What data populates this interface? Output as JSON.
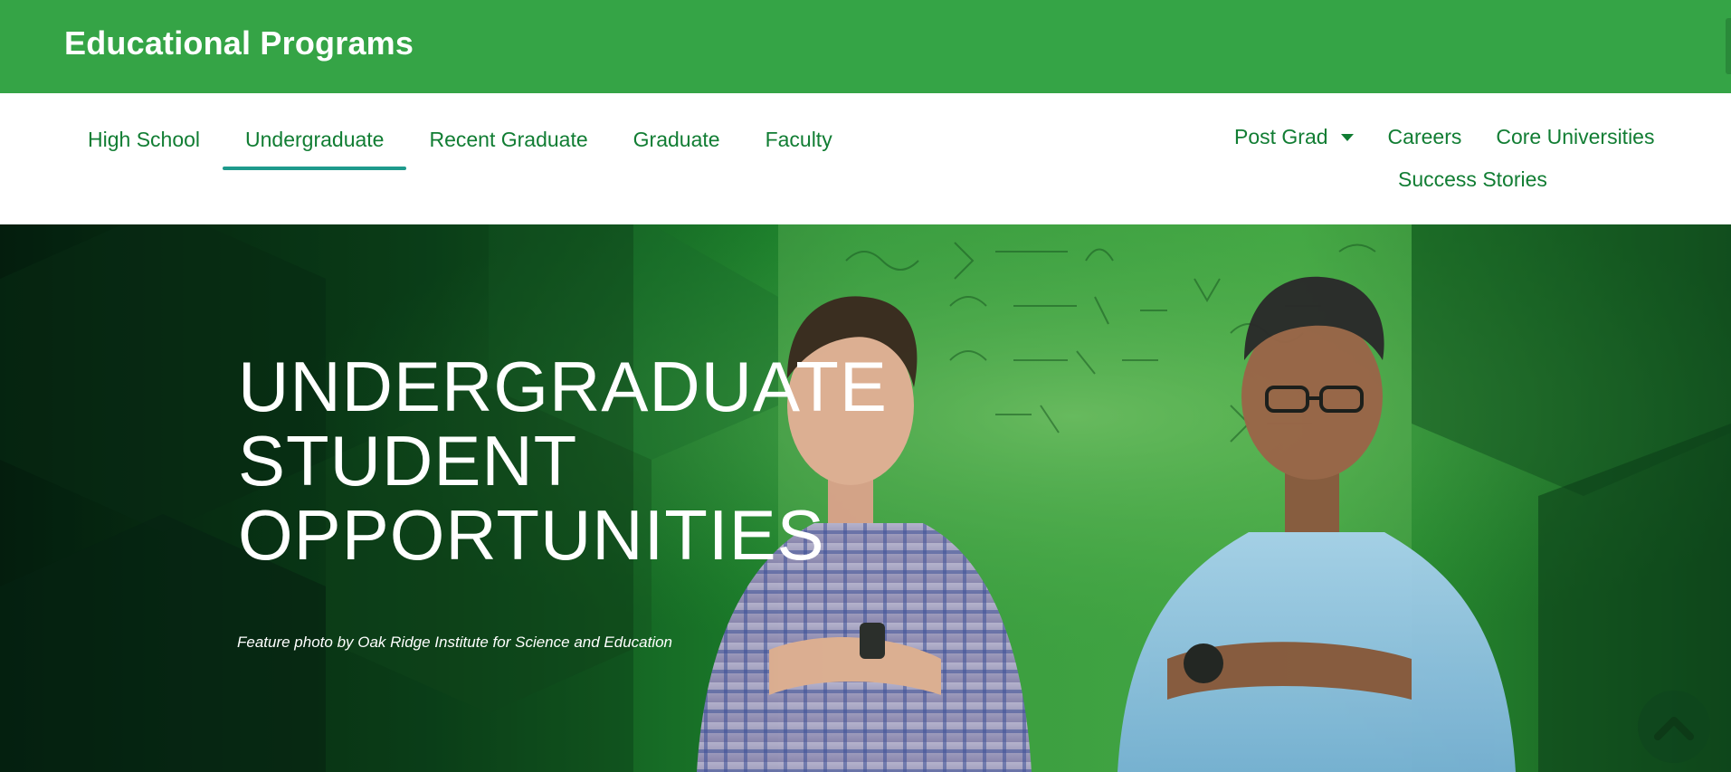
{
  "header": {
    "title": "Educational Programs",
    "background_color": "#35a446"
  },
  "nav": {
    "tabs": [
      {
        "label": "High School",
        "active": false
      },
      {
        "label": "Undergraduate",
        "active": true
      },
      {
        "label": "Recent Graduate",
        "active": false
      },
      {
        "label": "Graduate",
        "active": false
      },
      {
        "label": "Faculty",
        "active": false
      }
    ],
    "secondary": {
      "post_grad": "Post Grad",
      "careers": "Careers",
      "core_universities": "Core Universities",
      "success_stories": "Success Stories"
    },
    "link_color": "#117d33",
    "active_underline_color": "#1e9a8c"
  },
  "hero": {
    "title_lines": [
      "UNDERGRADUATE",
      "STUDENT",
      "OPPORTUNITIES"
    ],
    "credit": "Feature photo by Oak Ridge Institute for Science and Education",
    "back_to_top_icon": "chevron-up-icon"
  }
}
